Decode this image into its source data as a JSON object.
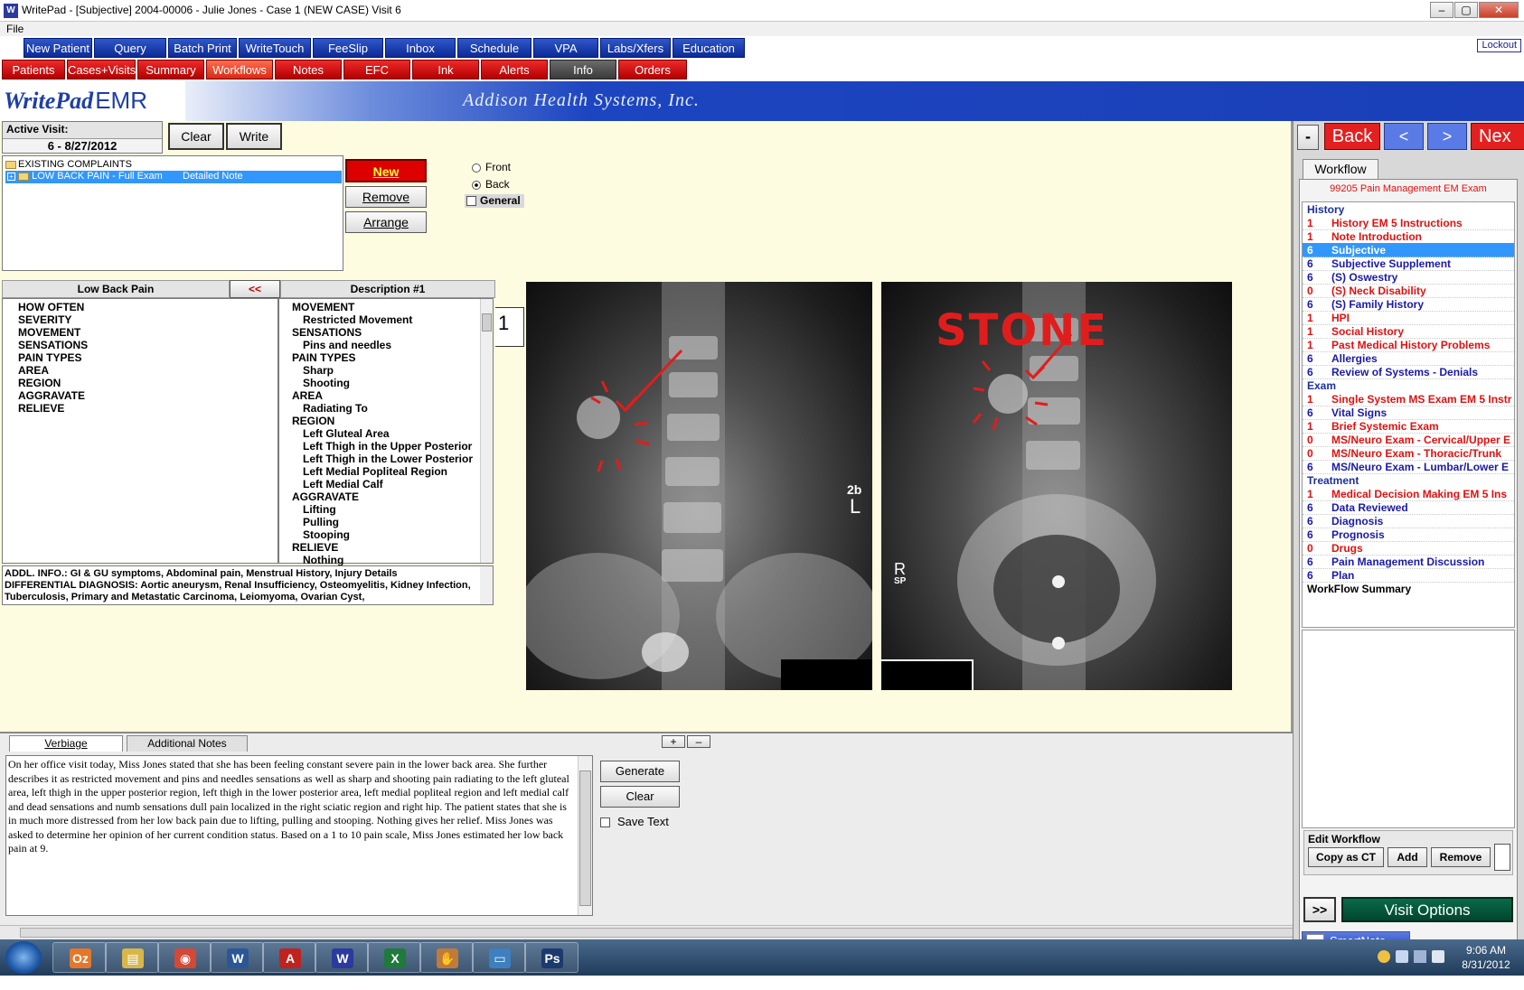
{
  "window": {
    "title": "WritePad - [Subjective] 2004-00006 - Julie Jones - Case 1 (NEW CASE)  Visit 6",
    "app_icon": "W",
    "minimize_label": "–",
    "maximize_label": "▢",
    "close_label": "✕"
  },
  "menu": {
    "file": "File"
  },
  "nav_row1": [
    "New Patient",
    "Query",
    "Batch Print",
    "WriteTouch",
    "FeeSlip",
    "Inbox",
    "Schedule",
    "VPA",
    "Labs/Xfers",
    "Education"
  ],
  "lockout": "Lockout",
  "nav_row2": [
    "Patients",
    "Cases+Visits",
    "Summary",
    "Workflows",
    "Notes",
    "EFC",
    "Ink",
    "Alerts",
    "Info",
    "Orders"
  ],
  "banner": {
    "logo": "WritePad",
    "logo_suffix": "EMR",
    "company": "Addison Health Systems, Inc."
  },
  "active_visit": {
    "label": "Active Visit:",
    "value": "6 - 8/27/2012",
    "clear_button": "Clear",
    "write_button": "Write"
  },
  "complaints": {
    "root": "EXISTING COMPLAINTS",
    "item": "LOW BACK PAIN - Full Exam",
    "item_note": "Detailed Note",
    "new_button": "New",
    "remove_button": "Remove",
    "arrange_button": "Arrange"
  },
  "view_options": {
    "front": "Front",
    "back": "Back",
    "general": "General"
  },
  "descriptors": {
    "left_header": "Low Back Pain",
    "collapse_button": "<<",
    "right_header": "Description #1",
    "categories": [
      "HOW OFTEN",
      "SEVERITY",
      "MOVEMENT",
      "SENSATIONS",
      "PAIN TYPES",
      "AREA",
      "REGION",
      "AGGRAVATE",
      "RELIEVE"
    ],
    "selections": [
      {
        "text": "MOVEMENT",
        "indent": false
      },
      {
        "text": "Restricted Movement",
        "indent": true
      },
      {
        "text": "SENSATIONS",
        "indent": false
      },
      {
        "text": "Pins and needles",
        "indent": true
      },
      {
        "text": "PAIN TYPES",
        "indent": false
      },
      {
        "text": "Sharp",
        "indent": true
      },
      {
        "text": "Shooting",
        "indent": true
      },
      {
        "text": "AREA",
        "indent": false
      },
      {
        "text": "Radiating To",
        "indent": true
      },
      {
        "text": "REGION",
        "indent": false
      },
      {
        "text": "Left Gluteal Area",
        "indent": true
      },
      {
        "text": "Left Thigh in the Upper Posterior",
        "indent": true
      },
      {
        "text": "Left Thigh in the Lower Posterior",
        "indent": true
      },
      {
        "text": "Left Medial Popliteal Region",
        "indent": true
      },
      {
        "text": "Left Medial Calf",
        "indent": true
      },
      {
        "text": "AGGRAVATE",
        "indent": false
      },
      {
        "text": "Lifting",
        "indent": true
      },
      {
        "text": "Pulling",
        "indent": true
      },
      {
        "text": "Stooping",
        "indent": true
      },
      {
        "text": "RELIEVE",
        "indent": false
      },
      {
        "text": "Nothing",
        "indent": true
      }
    ],
    "page_number": "1",
    "addl_info": "ADDL. INFO.:  GI & GU symptoms, Abdominal pain, Menstrual History, Injury Details",
    "differential": "DIFFERENTIAL DIAGNOSIS:  Aortic aneurysm, Renal Insufficiency, Osteomyelitis, Kidney Infection, Tuberculosis, Primary and Metastatic Carcinoma, Leiomyoma, Ovarian Cyst,"
  },
  "xray": {
    "annotation": "STONE",
    "left_marker": "L",
    "left_marker_num": "2b",
    "right_marker": "R",
    "right_marker_sub": "SP"
  },
  "notes": {
    "tab_verbiage": "Verbiage",
    "tab_additional": "Additional Notes",
    "plus": "+",
    "minus": "–",
    "text": "On her office visit today, Miss Jones stated that she has been feeling constant severe pain in the lower back area.  She further describes it as restricted movement and pins and needles sensations as well as sharp and shooting pain radiating to the left gluteal area, left thigh in the upper posterior region, left thigh in the lower posterior area, left medial popliteal region and left medial calf and dead sensations and numb sensations dull pain localized in the right sciatic region and right hip.  The patient states that she is in much more distressed from  her low back pain due to lifting, pulling and stooping.  Nothing gives her relief.  Miss Jones was asked to determine her opinion of her current condition status.  Based on a 1 to 10 pain scale, Miss Jones estimated her low back pain at 9.",
    "generate_button": "Generate",
    "clear_button": "Clear",
    "save_text": "Save Text"
  },
  "workflow": {
    "collapse": "-",
    "back": "Back",
    "prev": "<",
    "next": ">",
    "next_full": "Nex",
    "tab": "Workflow",
    "exam_name": "99205 Pain Management EM Exam",
    "sections": [
      {
        "header": "History",
        "items": [
          {
            "n": "1",
            "t": "History EM 5 Instructions",
            "c": "red"
          },
          {
            "n": "1",
            "t": "Note Introduction",
            "c": "red"
          },
          {
            "n": "6",
            "t": "Subjective",
            "c": "blue",
            "sel": true
          },
          {
            "n": "6",
            "t": "Subjective Supplement",
            "c": "blue"
          },
          {
            "n": "6",
            "t": "(S) Oswestry",
            "c": "blue"
          },
          {
            "n": "0",
            "t": "(S) Neck Disability",
            "c": "red"
          },
          {
            "n": "6",
            "t": "(S) Family History",
            "c": "blue"
          },
          {
            "n": "1",
            "t": "HPI",
            "c": "red"
          },
          {
            "n": "1",
            "t": "Social History",
            "c": "red"
          },
          {
            "n": "1",
            "t": "Past Medical History Problems",
            "c": "red"
          },
          {
            "n": "6",
            "t": "Allergies",
            "c": "blue"
          },
          {
            "n": "6",
            "t": "Review of Systems - Denials",
            "c": "blue"
          }
        ]
      },
      {
        "header": "Exam",
        "items": [
          {
            "n": "1",
            "t": "Single System MS Exam EM 5 Instr",
            "c": "red"
          },
          {
            "n": "6",
            "t": "Vital Signs",
            "c": "blue"
          },
          {
            "n": "1",
            "t": "Brief Systemic Exam",
            "c": "red"
          },
          {
            "n": "0",
            "t": "MS/Neuro Exam - Cervical/Upper E",
            "c": "red"
          },
          {
            "n": "0",
            "t": "MS/Neuro Exam - Thoracic/Trunk",
            "c": "red"
          },
          {
            "n": "6",
            "t": "MS/Neuro Exam - Lumbar/Lower E",
            "c": "blue"
          }
        ]
      },
      {
        "header": "Treatment",
        "items": [
          {
            "n": "1",
            "t": "Medical Decision Making EM 5 Ins",
            "c": "red"
          },
          {
            "n": "6",
            "t": "Data Reviewed",
            "c": "blue"
          },
          {
            "n": "6",
            "t": "Diagnosis",
            "c": "blue"
          },
          {
            "n": "6",
            "t": "Prognosis",
            "c": "blue"
          },
          {
            "n": "0",
            "t": "Drugs",
            "c": "red"
          },
          {
            "n": "6",
            "t": "Pain Management Discussion",
            "c": "blue"
          },
          {
            "n": "6",
            "t": "Plan",
            "c": "blue"
          }
        ]
      }
    ],
    "summary": "WorkFlow Summary",
    "edit_label": "Edit Workflow",
    "copy_ct": "Copy as CT",
    "add": "Add",
    "remove": "Remove",
    "expand": ">>",
    "visit_options": "Visit Options",
    "smartnote": "SmartNote"
  },
  "taskbar": {
    "apps": [
      {
        "label": "Oz",
        "color": "#e4772a"
      },
      {
        "label": "▤",
        "color": "#d9b64a"
      },
      {
        "label": "◉",
        "color": "#d34836"
      },
      {
        "label": "W",
        "color": "#2b5797"
      },
      {
        "label": "A",
        "color": "#c0221e"
      },
      {
        "label": "W",
        "color": "#2a3a9e"
      },
      {
        "label": "X",
        "color": "#1f7a3b"
      },
      {
        "label": "✋",
        "color": "#c07a3a"
      },
      {
        "label": "▭",
        "color": "#3e7fbf"
      },
      {
        "label": "Ps",
        "color": "#1b3a6e"
      }
    ],
    "time": "9:06 AM",
    "date": "8/31/2012"
  }
}
